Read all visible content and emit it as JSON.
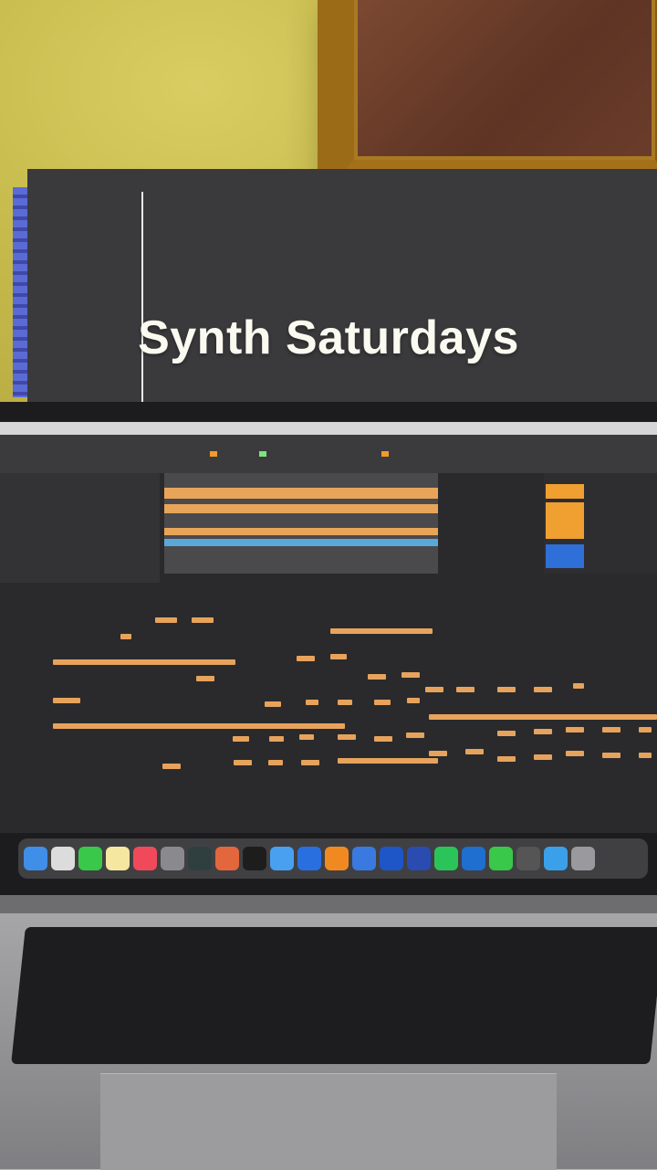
{
  "caption": "Synth Saturdays",
  "dock_icons": [
    "finder-icon",
    "launchpad-icon",
    "messages-icon",
    "notes-icon",
    "music-icon",
    "settings-icon",
    "activity-monitor-icon",
    "brave-icon",
    "ableton-live-icon",
    "app-icon",
    "app-icon",
    "app-icon",
    "app-icon",
    "app-icon",
    "photoshop-icon",
    "whatsapp-icon",
    "outlook-icon",
    "facetime-icon",
    "app-icon",
    "folder-icon",
    "trash-icon"
  ],
  "colors": {
    "wall": "#c9bd52",
    "clip": "#e8a55a",
    "accent_blue": "#2f6fd8"
  }
}
